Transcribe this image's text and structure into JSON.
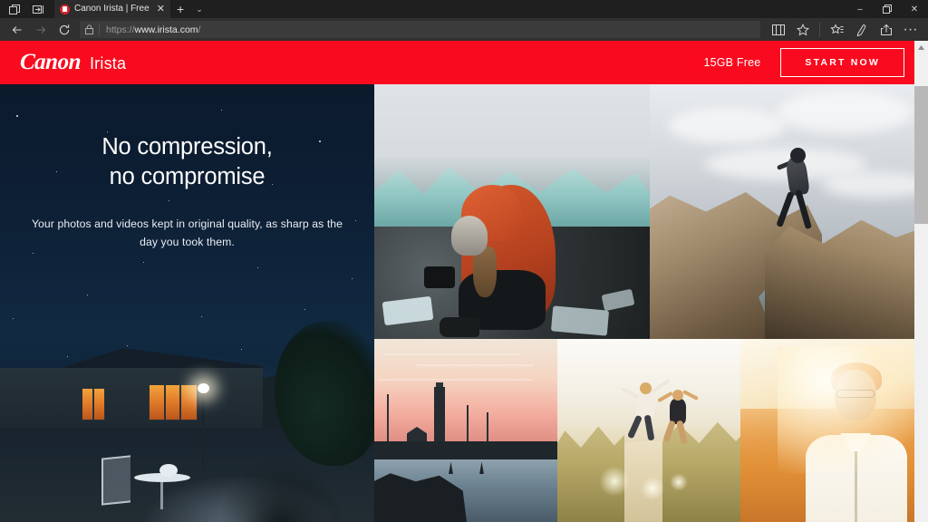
{
  "browser": {
    "tab": {
      "title": "Canon Irista | Free Clou",
      "close_label": "✕",
      "favicon_name": "canon-favicon"
    },
    "new_tab_label": "+",
    "tab_list_chevron": "⌄",
    "system_buttons": [
      {
        "name": "tab-preview-button",
        "label": ""
      },
      {
        "name": "set-tabs-aside-button",
        "label": ""
      }
    ],
    "window_controls": {
      "minimize": "–",
      "maximize": "❐",
      "close": "✕"
    },
    "nav": {
      "back_label": "←",
      "forward_label": "→",
      "refresh_label": "↻"
    },
    "address": {
      "prefix": "https://",
      "host": "www.irista.com",
      "suffix": "/",
      "lock_icon": "lock-icon"
    },
    "toolbar_icons": [
      {
        "name": "reading-view-icon",
        "label": ""
      },
      {
        "name": "favorite-star-icon",
        "label": ""
      },
      {
        "name": "collections-icon",
        "label": ""
      },
      {
        "name": "web-notes-pen-icon",
        "label": ""
      },
      {
        "name": "share-icon",
        "label": ""
      },
      {
        "name": "more-options-icon",
        "label": "···"
      }
    ]
  },
  "site": {
    "header": {
      "brand_canon": "Canon",
      "brand_product": "Irista",
      "free_storage_label": "15GB Free",
      "cta_label": "START NOW",
      "background_color": "#fa0a1e"
    },
    "hero": {
      "title_line1": "No compression,",
      "title_line2": "no compromise",
      "subtitle": "Your photos and videos kept in original quality, as sharp as the day you took them.",
      "background_name": "night-cabin-photo"
    },
    "gallery": {
      "photos": [
        {
          "name": "photo-glacier-photographer",
          "alt": "Photographer in orange jacket crouching on icy beach"
        },
        {
          "name": "photo-rock-leap",
          "alt": "Person leaping between coastal rocks under cloudy sky"
        },
        {
          "name": "photo-lighthouse-sunset",
          "alt": "Lighthouse silhouette at pink sunset over water"
        },
        {
          "name": "photo-dune-jumpers",
          "alt": "Two people jumping on a sand dune"
        },
        {
          "name": "photo-backlit-man",
          "alt": "Man with backpack backlit by golden sunlight"
        }
      ]
    }
  },
  "scrollbar": {
    "up_arrow": "▲",
    "position_percent": 0
  }
}
